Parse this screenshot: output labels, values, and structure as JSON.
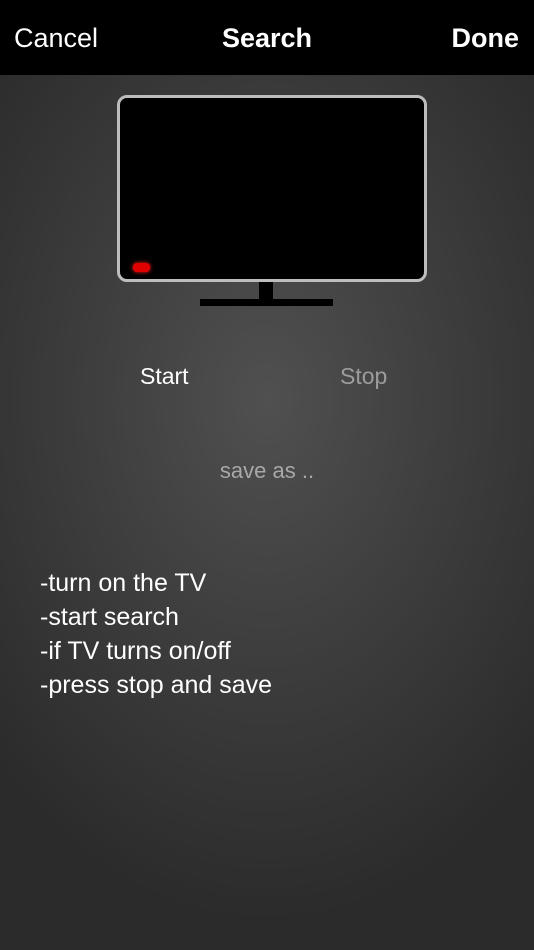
{
  "navbar": {
    "cancel_label": "Cancel",
    "title": "Search",
    "done_label": "Done"
  },
  "tv": {
    "indicator_color": "#e00000",
    "frame_color": "#bdbdbd"
  },
  "controls": {
    "start_label": "Start",
    "stop_label": "Stop",
    "save_as_label": "save as .."
  },
  "instructions": [
    "-turn on the TV",
    "-start search",
    "-if TV turns on/off",
    "-press stop and save"
  ]
}
